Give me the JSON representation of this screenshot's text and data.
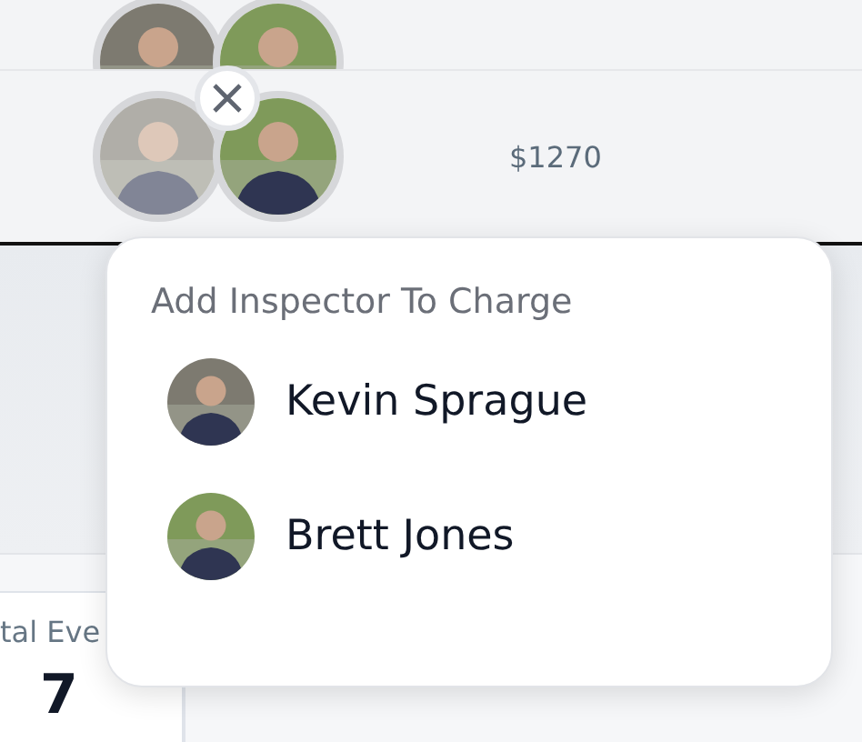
{
  "table": {
    "rows": [
      {
        "inspectors": [
          {
            "dimmed": false,
            "removable": false
          },
          {
            "dimmed": false,
            "removable": false
          }
        ]
      },
      {
        "inspectors": [
          {
            "dimmed": true,
            "removable": true
          },
          {
            "dimmed": false,
            "removable": false
          }
        ],
        "amount": "$1270"
      }
    ]
  },
  "stat": {
    "label": "tal Eve",
    "value": "7"
  },
  "popup": {
    "title": "Add Inspector To Charge",
    "options": [
      {
        "name": "Kevin Sprague"
      },
      {
        "name": "Brett Jones"
      }
    ]
  }
}
